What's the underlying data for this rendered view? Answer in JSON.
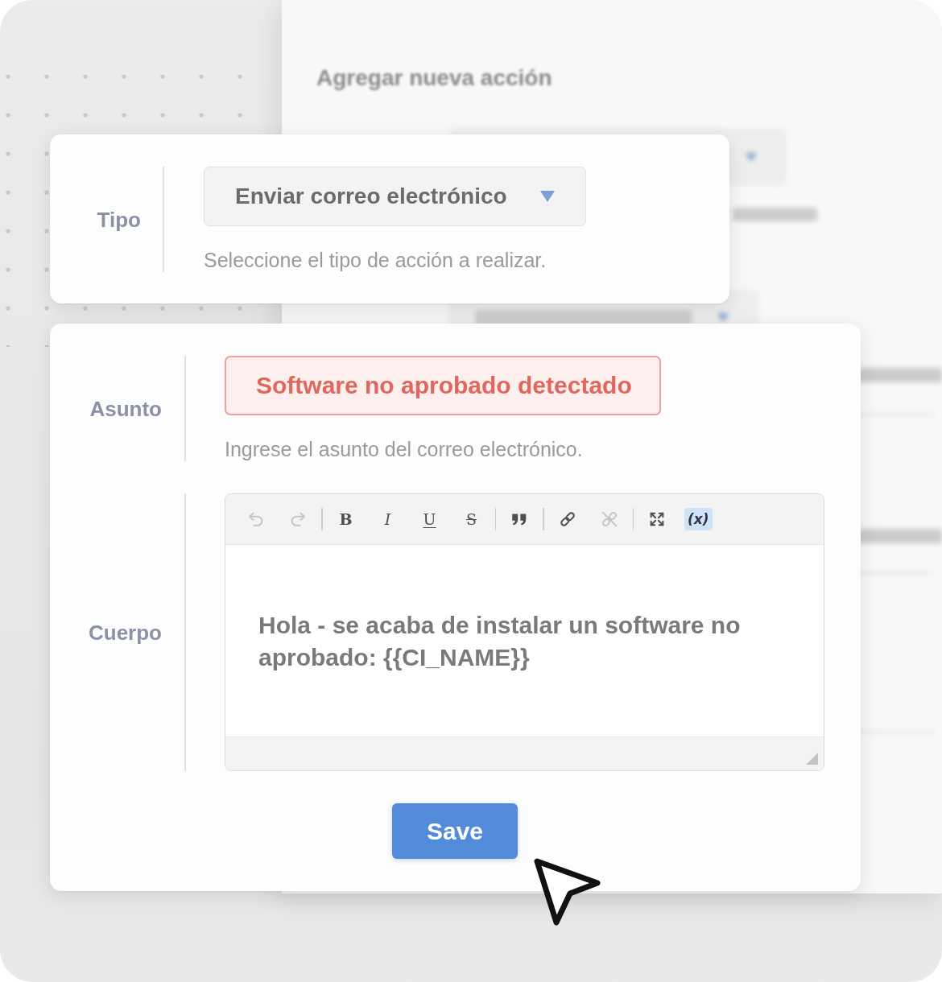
{
  "background_panel": {
    "title": "Agregar nueva acción"
  },
  "type_card": {
    "label": "Tipo",
    "dropdown": {
      "value": "Enviar correo electrónico"
    },
    "help": "Seleccione el tipo de acción a realizar."
  },
  "email_card": {
    "subject": {
      "label": "Asunto",
      "value": "Software no aprobado detectado",
      "error": true,
      "help": "Ingrese el asunto del correo electrónico."
    },
    "body": {
      "label": "Cuerpo",
      "toolbar": [
        {
          "kind": "undo",
          "disabled": true,
          "active": false
        },
        {
          "kind": "redo",
          "disabled": true,
          "active": false
        },
        {
          "kind": "separator"
        },
        {
          "kind": "bold",
          "label": "B",
          "disabled": false,
          "active": false
        },
        {
          "kind": "italic",
          "label": "I",
          "disabled": false,
          "active": false
        },
        {
          "kind": "underline",
          "label": "U",
          "disabled": false,
          "active": false
        },
        {
          "kind": "strikethrough",
          "label": "S",
          "disabled": false,
          "active": false
        },
        {
          "kind": "separator"
        },
        {
          "kind": "blockquote",
          "disabled": false,
          "active": false
        },
        {
          "kind": "separator"
        },
        {
          "kind": "link",
          "disabled": false,
          "active": false
        },
        {
          "kind": "unlink",
          "disabled": true,
          "active": false
        },
        {
          "kind": "separator"
        },
        {
          "kind": "maximize",
          "disabled": false,
          "active": false
        },
        {
          "kind": "variable",
          "label": "(x)",
          "disabled": false,
          "active": true
        }
      ],
      "value": "Hola - se acaba de instalar un software no aprobado: {{CI_NAME}}"
    },
    "save_button": {
      "label": "Save"
    }
  }
}
